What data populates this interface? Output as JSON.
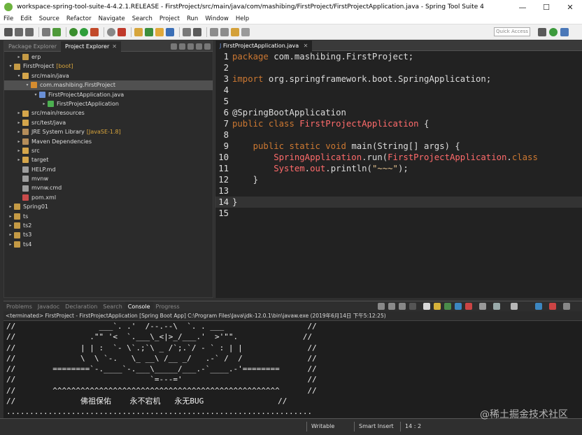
{
  "window": {
    "title": "workspace-spring-tool-suite-4-4.2.1.RELEASE - FirstProject/src/main/java/com/mashibing/FirstProject/FirstProjectApplication.java - Spring Tool Suite 4",
    "minimize": "—",
    "maximize": "☐",
    "close": "✕"
  },
  "menu": [
    "File",
    "Edit",
    "Source",
    "Refactor",
    "Navigate",
    "Search",
    "Project",
    "Run",
    "Window",
    "Help"
  ],
  "toolbar": {
    "quick_access": "Quick Access"
  },
  "explorer": {
    "tabs": [
      {
        "label": "Package Explorer"
      },
      {
        "label": "Project Explorer",
        "close": "✕"
      }
    ],
    "tree": [
      {
        "label": "erp",
        "hint": "",
        "indent": 1,
        "arrow": "▸",
        "icon": "project-icon",
        "color": "#c49a45"
      },
      {
        "label": "FirstProject",
        "hint": "[boot]",
        "indent": 0,
        "arrow": "▾",
        "icon": "project-icon",
        "color": "#c49a45"
      },
      {
        "label": "src/main/java",
        "hint": "",
        "indent": 1,
        "arrow": "▾",
        "icon": "source-folder-icon",
        "color": "#d5a64b"
      },
      {
        "label": "com.mashibing.FirstProject",
        "hint": "",
        "indent": 2,
        "arrow": "▾",
        "icon": "package-icon",
        "color": "#d58c2f"
      },
      {
        "label": "FirstProjectApplication.java",
        "hint": "",
        "indent": 3,
        "arrow": "▾",
        "icon": "java-file-icon",
        "color": "#6a8fd6"
      },
      {
        "label": "FirstProjectApplication",
        "hint": "",
        "indent": 4,
        "arrow": "▸",
        "icon": "class-icon",
        "color": "#4caf50"
      },
      {
        "label": "src/main/resources",
        "hint": "",
        "indent": 1,
        "arrow": "▸",
        "icon": "source-folder-icon",
        "color": "#d5a64b"
      },
      {
        "label": "src/test/java",
        "hint": "",
        "indent": 1,
        "arrow": "▸",
        "icon": "source-folder-icon",
        "color": "#d5a64b"
      },
      {
        "label": "JRE System Library",
        "hint": "[JavaSE-1.8]",
        "indent": 1,
        "arrow": "▸",
        "icon": "library-icon",
        "color": "#b58d5a"
      },
      {
        "label": "Maven Dependencies",
        "hint": "",
        "indent": 1,
        "arrow": "▸",
        "icon": "library-icon",
        "color": "#b58d5a"
      },
      {
        "label": "src",
        "hint": "",
        "indent": 1,
        "arrow": "▸",
        "icon": "folder-icon",
        "color": "#d5a64b"
      },
      {
        "label": "target",
        "hint": "",
        "indent": 1,
        "arrow": "▸",
        "icon": "folder-icon",
        "color": "#d5a64b"
      },
      {
        "label": "HELP.md",
        "hint": "",
        "indent": 1,
        "arrow": "",
        "icon": "file-icon",
        "color": "#9e9e9e"
      },
      {
        "label": "mvnw",
        "hint": "",
        "indent": 1,
        "arrow": "",
        "icon": "file-icon",
        "color": "#9e9e9e"
      },
      {
        "label": "mvnw.cmd",
        "hint": "",
        "indent": 1,
        "arrow": "",
        "icon": "file-icon",
        "color": "#9e9e9e"
      },
      {
        "label": "pom.xml",
        "hint": "",
        "indent": 1,
        "arrow": "",
        "icon": "xml-file-icon",
        "color": "#c94b4b"
      },
      {
        "label": "Spring01",
        "hint": "",
        "indent": 0,
        "arrow": "▸",
        "icon": "project-icon",
        "color": "#c49a45"
      },
      {
        "label": "ts",
        "hint": "",
        "indent": 0,
        "arrow": "▸",
        "icon": "project-icon",
        "color": "#c49a45"
      },
      {
        "label": "ts2",
        "hint": "",
        "indent": 0,
        "arrow": "▸",
        "icon": "project-icon",
        "color": "#c49a45"
      },
      {
        "label": "ts3",
        "hint": "",
        "indent": 0,
        "arrow": "▸",
        "icon": "project-icon",
        "color": "#c49a45"
      },
      {
        "label": "ts4",
        "hint": "",
        "indent": 0,
        "arrow": "▸",
        "icon": "project-icon",
        "color": "#c49a45"
      }
    ]
  },
  "editor": {
    "tab": {
      "label": "FirstProjectApplication.java",
      "close": "✕"
    },
    "lines": [
      {
        "n": "1",
        "text": "package com.mashibing.FirstProject;"
      },
      {
        "n": "2",
        "text": ""
      },
      {
        "n": "3",
        "text": "import org.springframework.boot.SpringApplication;"
      },
      {
        "n": "4",
        "text": ""
      },
      {
        "n": "5",
        "text": ""
      },
      {
        "n": "6",
        "text": "@SpringBootApplication"
      },
      {
        "n": "7",
        "text": "public class FirstProjectApplication {"
      },
      {
        "n": "8",
        "text": ""
      },
      {
        "n": "9",
        "text": "    public static void main(String[] args) {"
      },
      {
        "n": "10",
        "text": "        SpringApplication.run(FirstProjectApplication.class"
      },
      {
        "n": "11",
        "text": "        System.out.println(\"~~~\");"
      },
      {
        "n": "12",
        "text": "    }"
      },
      {
        "n": "13",
        "text": ""
      },
      {
        "n": "14",
        "text": "}"
      },
      {
        "n": "15",
        "text": ""
      }
    ]
  },
  "console": {
    "tabs": [
      "Problems",
      "Javadoc",
      "Declaration",
      "Search",
      "Console",
      "Progress"
    ],
    "active_tab": "Console",
    "header": "<terminated> FirstProject - FirstProjectApplication [Spring Boot App] C:\\Program Files\\Java\\jdk-12.0.1\\bin\\javaw.exe (2019年6月14日 下午5:12:25)",
    "lines": [
      "//                  ___`. .'  /--.--\\  `. . ___                  //",
      "//                .\"\" '<  `.___\\_<|>_/___.'  >'\"\".              //",
      "//              | | :  `- \\`.;`\\ _ /`;.`/ - ` : | |              //",
      "//              \\  \\ `-.   \\_ __\\ /__ _/   .-` /  /              //",
      "//        ========`-.____`-.___\\_____/___.-`____.-'========      //",
      "//                             `=---='                           //",
      "//        ^^^^^^^^^^^^^^^^^^^^^^^^^^^^^^^^^^^^^^^^^^^^^^^^^      //",
      "//              佛祖保佑    永不宕机   永无BUG                //",
      ".................................................................."
    ]
  },
  "status": {
    "writable": "Writable",
    "insert_mode": "Smart Insert",
    "position": "14 : 2"
  },
  "watermark": "@稀土掘金技术社区"
}
